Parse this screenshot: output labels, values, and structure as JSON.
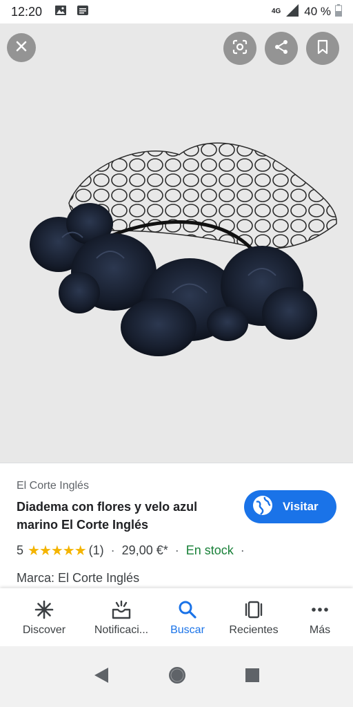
{
  "status_bar": {
    "time": "12:20",
    "network": "4G",
    "battery": "40 %",
    "icons": [
      "image-icon",
      "message-icon",
      "signal-icon",
      "battery-icon"
    ]
  },
  "image_viewer": {
    "icons": [
      "close-icon",
      "lens-icon",
      "share-icon",
      "bookmark-icon"
    ],
    "background": "#e8e8e8"
  },
  "product": {
    "source": "El Corte Inglés",
    "title": "Diadema con flores y velo azul marino El Corte Inglés",
    "visit_label": "Visitar",
    "rating": "5",
    "stars": "★★★★★",
    "review_count": "(1)",
    "separator": "·",
    "price": "29,00 €*",
    "stock": "En stock",
    "brand": "Marca: El Corte Inglés"
  },
  "bottom_nav": {
    "items": [
      {
        "label": "Discover",
        "icon": "asterisk-icon"
      },
      {
        "label": "Notificaci...",
        "icon": "notifications-icon"
      },
      {
        "label": "Buscar",
        "icon": "search-icon",
        "active": true
      },
      {
        "label": "Recientes",
        "icon": "recents-icon"
      },
      {
        "label": "Más",
        "icon": "more-icon"
      }
    ]
  },
  "colors": {
    "accent": "#1a73e8",
    "star": "#f4b400",
    "in_stock": "#188038"
  }
}
